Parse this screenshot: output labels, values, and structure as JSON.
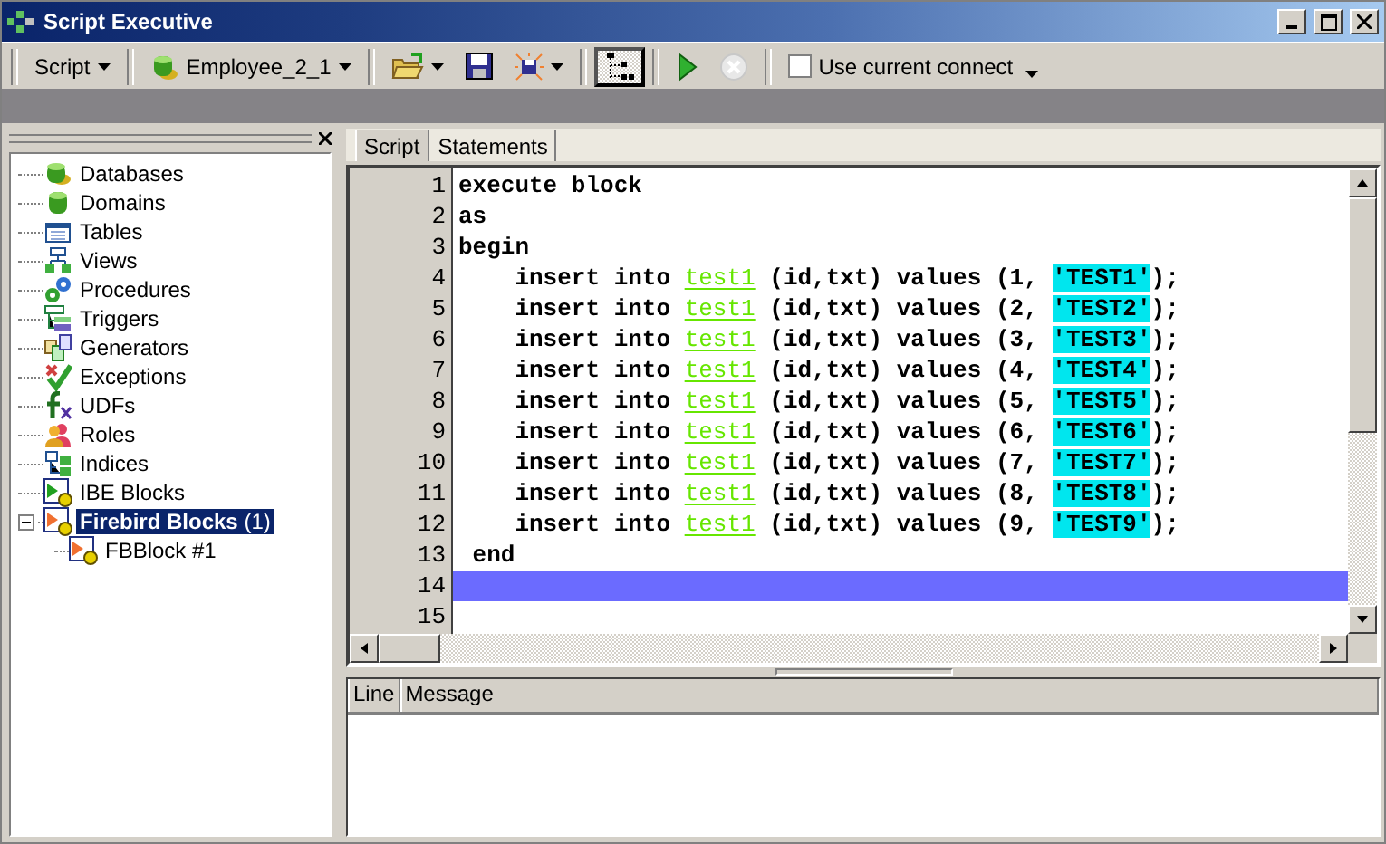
{
  "window": {
    "title": "Script Executive"
  },
  "toolbar": {
    "script_menu": "Script",
    "connection": "Employee_2_1",
    "tree_toggle_pressed": true,
    "stop_disabled": true,
    "use_current_connect": {
      "label": "Use current connect",
      "checked": false
    }
  },
  "tree": {
    "items": [
      {
        "label": "Databases",
        "kind": "database",
        "selected": false
      },
      {
        "label": "Domains",
        "kind": "domain",
        "selected": false
      },
      {
        "label": "Tables",
        "kind": "table",
        "selected": false
      },
      {
        "label": "Views",
        "kind": "view",
        "selected": false
      },
      {
        "label": "Procedures",
        "kind": "procedure",
        "selected": false
      },
      {
        "label": "Triggers",
        "kind": "trigger",
        "selected": false
      },
      {
        "label": "Generators",
        "kind": "generator",
        "selected": false
      },
      {
        "label": "Exceptions",
        "kind": "exception",
        "selected": false
      },
      {
        "label": "UDFs",
        "kind": "udf",
        "selected": false
      },
      {
        "label": "Roles",
        "kind": "role",
        "selected": false
      },
      {
        "label": "Indices",
        "kind": "index",
        "selected": false
      },
      {
        "label": "IBE Blocks",
        "kind": "ibe_block",
        "selected": false
      },
      {
        "label": "**Firebird Blocks** (1)",
        "kind": "fb_block",
        "selected": true,
        "expanded": true,
        "children": [
          {
            "label": "FBBlock #1",
            "kind": "fb_block",
            "selected": false
          }
        ]
      }
    ]
  },
  "tabs": [
    {
      "label": "Script",
      "selected": true
    },
    {
      "label": "Statements",
      "selected": false
    }
  ],
  "editor": {
    "lines": [
      {
        "number": "1",
        "current": false,
        "segments": [
          {
            "kind": "keyword",
            "text": "execute block"
          }
        ]
      },
      {
        "number": "2",
        "current": false,
        "segments": [
          {
            "kind": "keyword",
            "text": "as"
          }
        ]
      },
      {
        "number": "3",
        "current": false,
        "segments": [
          {
            "kind": "keyword",
            "text": "begin"
          }
        ]
      },
      {
        "number": "4",
        "current": false,
        "segments": [
          {
            "kind": "keyword",
            "text": "    insert into "
          },
          {
            "kind": "identifier",
            "text": "test1"
          },
          {
            "kind": "keyword",
            "text": " (id,txt) values (1, "
          },
          {
            "kind": "string",
            "text": "'TEST1'"
          },
          {
            "kind": "keyword",
            "text": ");"
          }
        ]
      },
      {
        "number": "5",
        "current": false,
        "segments": [
          {
            "kind": "keyword",
            "text": "    insert into "
          },
          {
            "kind": "identifier",
            "text": "test1"
          },
          {
            "kind": "keyword",
            "text": " (id,txt) values (2, "
          },
          {
            "kind": "string",
            "text": "'TEST2'"
          },
          {
            "kind": "keyword",
            "text": ");"
          }
        ]
      },
      {
        "number": "6",
        "current": false,
        "segments": [
          {
            "kind": "keyword",
            "text": "    insert into "
          },
          {
            "kind": "identifier",
            "text": "test1"
          },
          {
            "kind": "keyword",
            "text": " (id,txt) values (3, "
          },
          {
            "kind": "string",
            "text": "'TEST3'"
          },
          {
            "kind": "keyword",
            "text": ");"
          }
        ]
      },
      {
        "number": "7",
        "current": false,
        "segments": [
          {
            "kind": "keyword",
            "text": "    insert into "
          },
          {
            "kind": "identifier",
            "text": "test1"
          },
          {
            "kind": "keyword",
            "text": " (id,txt) values (4, "
          },
          {
            "kind": "string",
            "text": "'TEST4'"
          },
          {
            "kind": "keyword",
            "text": ");"
          }
        ]
      },
      {
        "number": "8",
        "current": false,
        "segments": [
          {
            "kind": "keyword",
            "text": "    insert into "
          },
          {
            "kind": "identifier",
            "text": "test1"
          },
          {
            "kind": "keyword",
            "text": " (id,txt) values (5, "
          },
          {
            "kind": "string",
            "text": "'TEST5'"
          },
          {
            "kind": "keyword",
            "text": ");"
          }
        ]
      },
      {
        "number": "9",
        "current": false,
        "segments": [
          {
            "kind": "keyword",
            "text": "    insert into "
          },
          {
            "kind": "identifier",
            "text": "test1"
          },
          {
            "kind": "keyword",
            "text": " (id,txt) values (6, "
          },
          {
            "kind": "string",
            "text": "'TEST6'"
          },
          {
            "kind": "keyword",
            "text": ");"
          }
        ]
      },
      {
        "number": "10",
        "current": false,
        "segments": [
          {
            "kind": "keyword",
            "text": "    insert into "
          },
          {
            "kind": "identifier",
            "text": "test1"
          },
          {
            "kind": "keyword",
            "text": " (id,txt) values (7, "
          },
          {
            "kind": "string",
            "text": "'TEST7'"
          },
          {
            "kind": "keyword",
            "text": ");"
          }
        ]
      },
      {
        "number": "11",
        "current": false,
        "segments": [
          {
            "kind": "keyword",
            "text": "    insert into "
          },
          {
            "kind": "identifier",
            "text": "test1"
          },
          {
            "kind": "keyword",
            "text": " (id,txt) values (8, "
          },
          {
            "kind": "string",
            "text": "'TEST8'"
          },
          {
            "kind": "keyword",
            "text": ");"
          }
        ]
      },
      {
        "number": "12",
        "current": false,
        "segments": [
          {
            "kind": "keyword",
            "text": "    insert into "
          },
          {
            "kind": "identifier",
            "text": "test1"
          },
          {
            "kind": "keyword",
            "text": " (id,txt) values (9, "
          },
          {
            "kind": "string",
            "text": "'TEST9'"
          },
          {
            "kind": "keyword",
            "text": ");"
          }
        ]
      },
      {
        "number": "13",
        "current": false,
        "segments": [
          {
            "kind": "keyword",
            "text": " end"
          }
        ]
      },
      {
        "number": "14",
        "current": true
      },
      {
        "number": "15",
        "current": false
      }
    ]
  },
  "messages": {
    "columns": [
      "Line",
      "Message"
    ]
  }
}
